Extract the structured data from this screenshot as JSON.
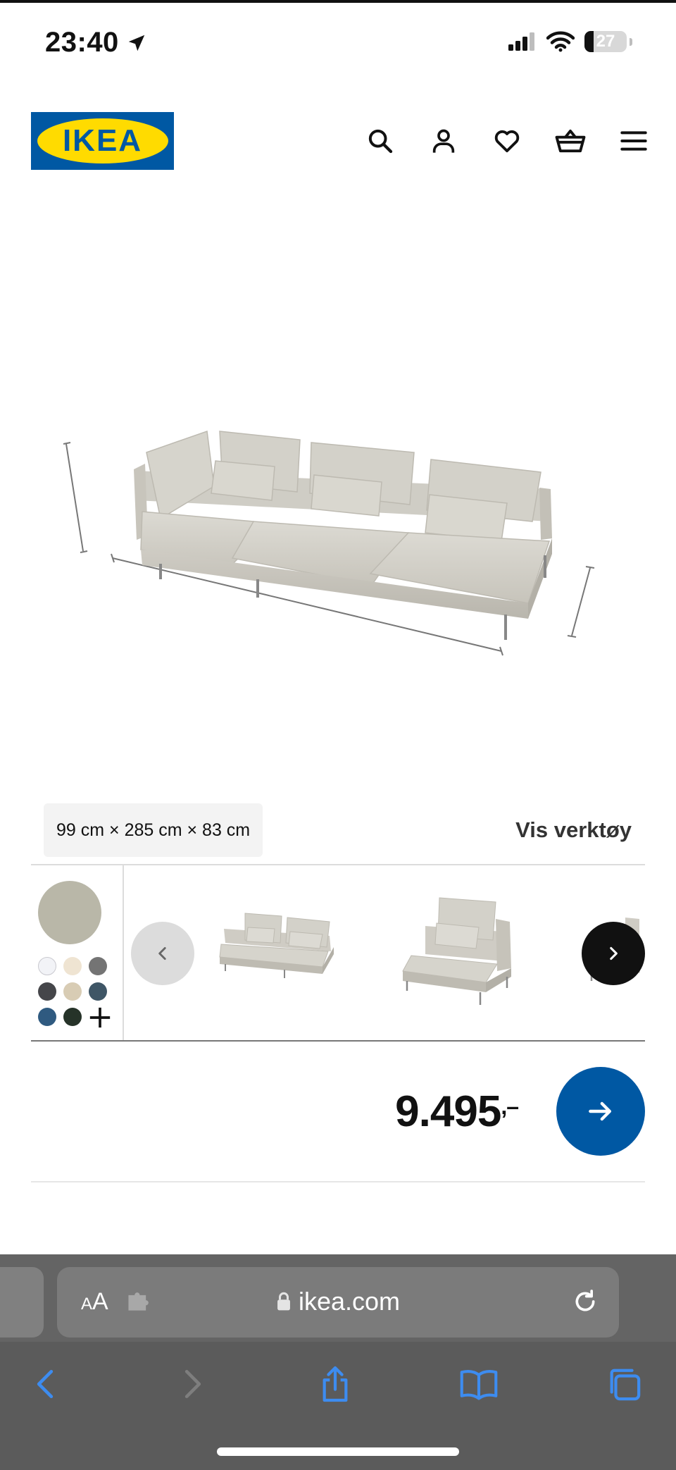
{
  "status_bar": {
    "time": "23:40",
    "battery": "27",
    "icons": [
      "location-arrow-icon",
      "cellular-signal-icon",
      "wifi-icon",
      "battery-icon"
    ]
  },
  "header": {
    "logo_text": "IKEA",
    "logo_colors": {
      "background": "#0058a3",
      "ellipse": "#ffdb00"
    },
    "icons": [
      "search-icon",
      "account-icon",
      "wishlist-heart-icon",
      "shopping-basket-icon",
      "menu-icon"
    ]
  },
  "product": {
    "dimensions": "99 cm × 285 cm × 83 cm",
    "tools_link": "Vis verktøy",
    "price_main": "9.495",
    "price_suffix": ",–"
  },
  "configurator": {
    "selected_color": "#b9b7a8",
    "swatches": [
      "#f2f3f7",
      "#efe4d2",
      "#747474",
      "#45464a",
      "#d8ccb4",
      "#3f5666",
      "#2f5a80",
      "#263329"
    ],
    "more_colors_icon": "plus-icon",
    "thumbnails": [
      "two-seat-section-thumbnail",
      "armchair-section-thumbnail",
      "partial-section-thumbnail"
    ]
  },
  "browser": {
    "aa_label_small": "A",
    "aa_label_large": "A",
    "url": "ikea.com",
    "toolbar_icons": [
      "back-icon",
      "forward-icon",
      "share-icon",
      "bookmarks-icon",
      "tabs-icon"
    ],
    "accent": "#3d8cf0"
  }
}
